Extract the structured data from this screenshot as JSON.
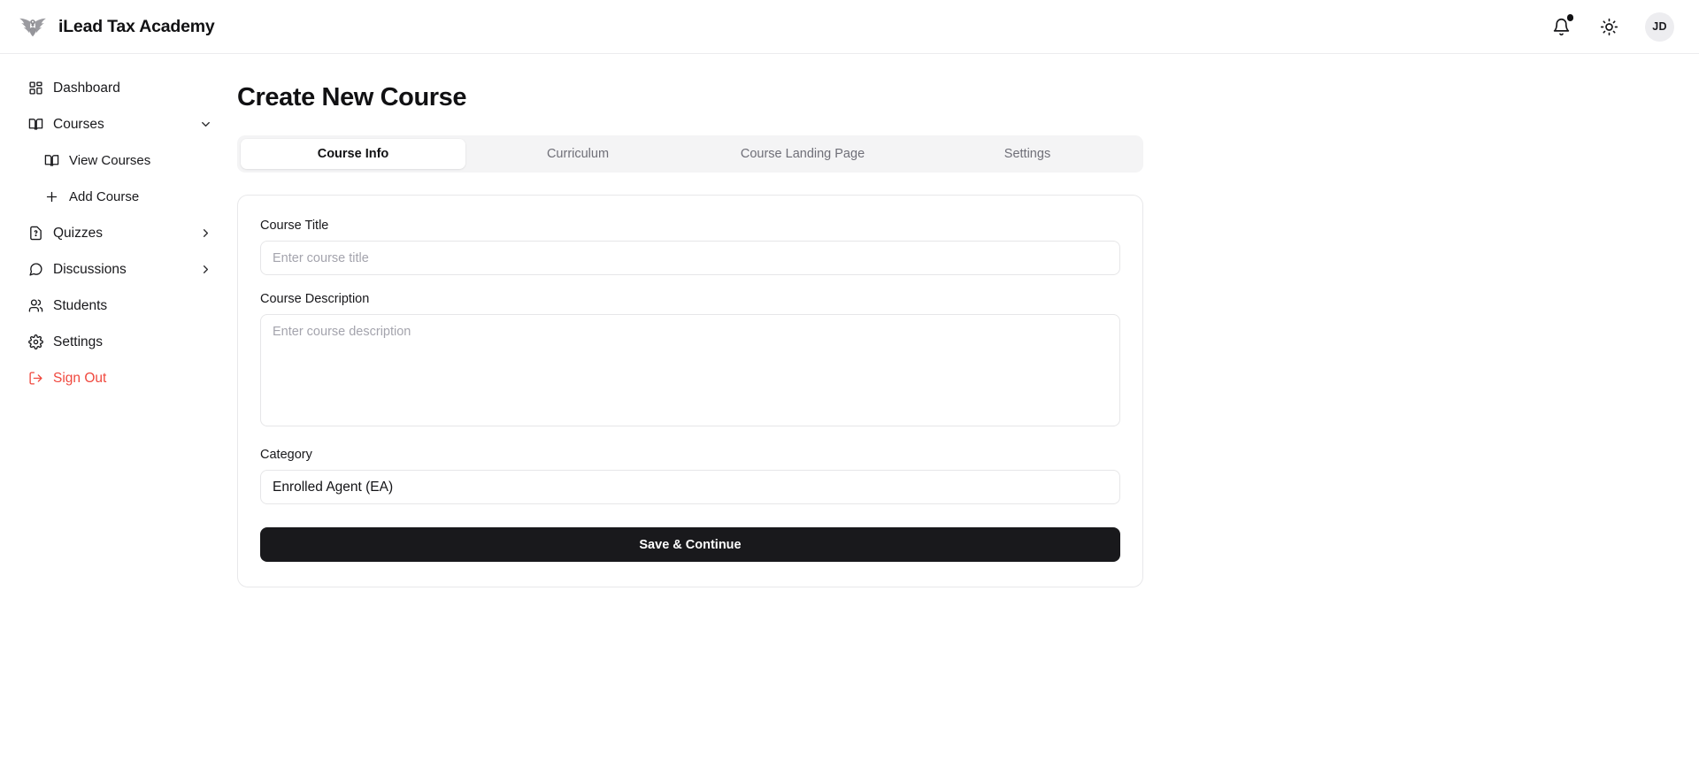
{
  "header": {
    "brand_name": "iLead Tax Academy",
    "logo_icon": "eagle-emblem-icon",
    "notifications_icon": "bell-icon",
    "theme_toggle_icon": "sun-icon",
    "avatar_initials": "JD",
    "badge_color": "#111113"
  },
  "sidebar": {
    "items": [
      {
        "label": "Dashboard",
        "icon": "grid-dashboard-icon",
        "chevron": "",
        "sub": false
      },
      {
        "label": "Courses",
        "icon": "book-icon",
        "chevron": "down",
        "sub": false
      },
      {
        "label": "View Courses",
        "icon": "book-icon",
        "chevron": "",
        "sub": true
      },
      {
        "label": "Add Course",
        "icon": "plus-icon",
        "chevron": "",
        "sub": true
      },
      {
        "label": "Quizzes",
        "icon": "file-question-icon",
        "chevron": "right",
        "sub": false
      },
      {
        "label": "Discussions",
        "icon": "message-icon",
        "chevron": "right",
        "sub": false
      },
      {
        "label": "Students",
        "icon": "users-icon",
        "chevron": "",
        "sub": false
      },
      {
        "label": "Settings",
        "icon": "gear-icon",
        "chevron": "",
        "sub": false
      },
      {
        "label": "Sign Out",
        "icon": "logout-icon",
        "chevron": "",
        "sub": false,
        "danger": true
      }
    ],
    "signout_color": "#f0483e"
  },
  "main": {
    "page_title": "Create New Course",
    "tabs": [
      {
        "label": "Course Info",
        "active": true
      },
      {
        "label": "Curriculum",
        "active": false
      },
      {
        "label": "Course Landing Page",
        "active": false
      },
      {
        "label": "Settings",
        "active": false
      }
    ],
    "form": {
      "title_label": "Course Title",
      "title_value": "",
      "title_placeholder": "Enter course title",
      "description_label": "Course Description",
      "description_value": "",
      "description_placeholder": "Enter course description",
      "category_label": "Category",
      "category_value": "Enrolled Agent (EA)",
      "submit_label": "Save & Continue"
    }
  }
}
